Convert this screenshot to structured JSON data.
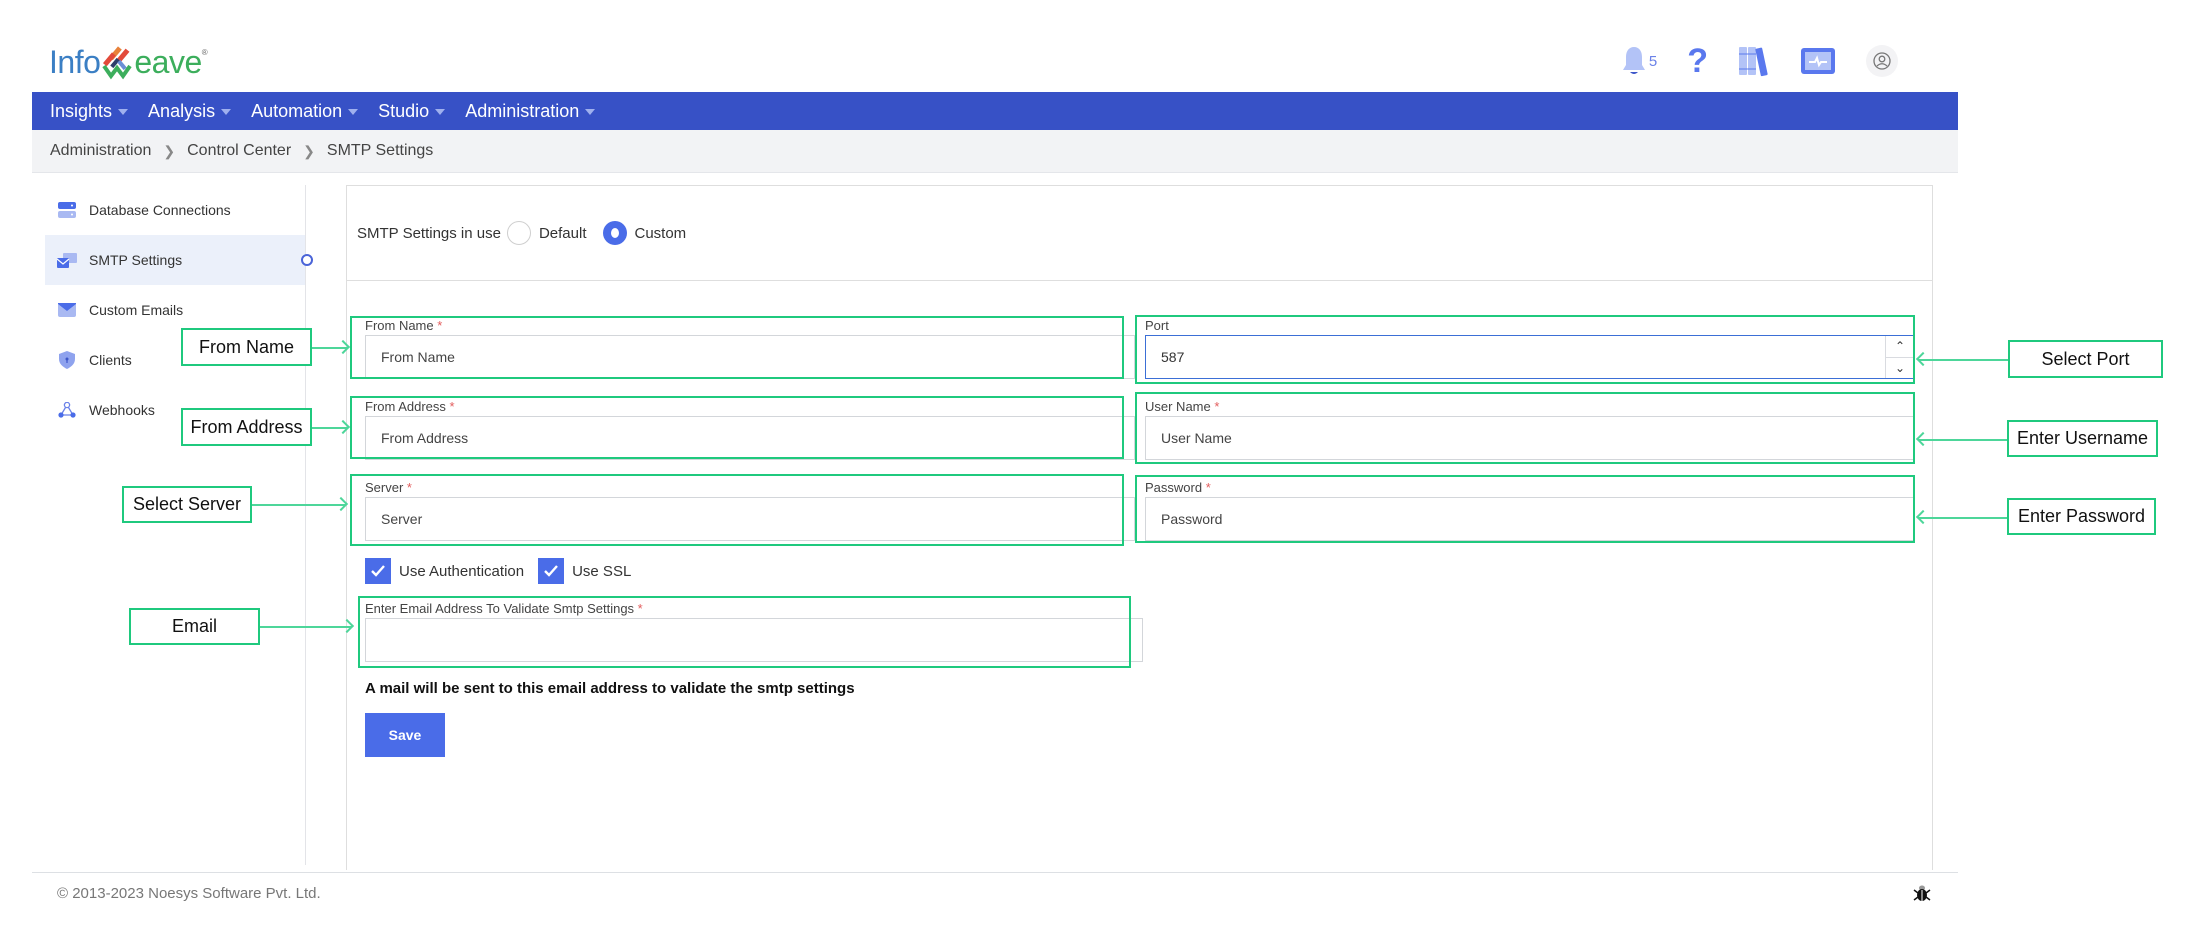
{
  "brand": {
    "name_left": "Info",
    "name_right": "eave",
    "registered": "®"
  },
  "header": {
    "notification_count": "5",
    "icons": [
      "bell-icon",
      "help-icon",
      "library-icon",
      "monitor-icon",
      "user-icon"
    ]
  },
  "nav": {
    "items": [
      {
        "label": "Insights"
      },
      {
        "label": "Analysis"
      },
      {
        "label": "Automation"
      },
      {
        "label": "Studio"
      },
      {
        "label": "Administration"
      }
    ]
  },
  "breadcrumb": [
    "Administration",
    "Control Center",
    "SMTP Settings"
  ],
  "sidebar": {
    "items": [
      {
        "label": "Database Connections",
        "icon": "database-icon"
      },
      {
        "label": "SMTP Settings",
        "icon": "smtp-icon",
        "active": true
      },
      {
        "label": "Custom Emails",
        "icon": "email-icon"
      },
      {
        "label": "Clients",
        "icon": "shield-icon"
      },
      {
        "label": "Webhooks",
        "icon": "webhook-icon"
      }
    ]
  },
  "form": {
    "smtp_in_use_label": "SMTP Settings in use",
    "options": [
      "Default",
      "Custom"
    ],
    "selected_option": "Custom",
    "from_name": {
      "label": "From Name",
      "placeholder": "From Name",
      "value": ""
    },
    "from_address": {
      "label": "From Address",
      "placeholder": "From Address",
      "value": ""
    },
    "server": {
      "label": "Server",
      "placeholder": "Server",
      "value": ""
    },
    "port": {
      "label": "Port",
      "value": "587"
    },
    "user_name": {
      "label": "User Name",
      "placeholder": "User Name",
      "value": ""
    },
    "password": {
      "label": "Password",
      "placeholder": "Password",
      "value": ""
    },
    "use_authentication": {
      "label": "Use Authentication",
      "checked": true
    },
    "use_ssl": {
      "label": "Use SSL",
      "checked": true
    },
    "validate_email": {
      "label": "Enter Email Address To Validate Smtp Settings",
      "placeholder": "",
      "value": ""
    },
    "required_mark": "*",
    "hint": "A mail will be sent to this email address to validate the smtp settings",
    "save_label": "Save"
  },
  "annotations": {
    "from_name": "From Name",
    "from_address": "From Address",
    "select_server": "Select Server",
    "email": "Email",
    "select_port": "Select Port",
    "enter_username": "Enter Username",
    "enter_password": "Enter Password"
  },
  "footer": {
    "copyright": "© 2013-2023 Noesys Software Pvt. Ltd."
  },
  "colors": {
    "nav": "#3751c6",
    "accent": "#4a6ce8",
    "annotation": "#1fc97e",
    "required": "#e25c5c"
  }
}
